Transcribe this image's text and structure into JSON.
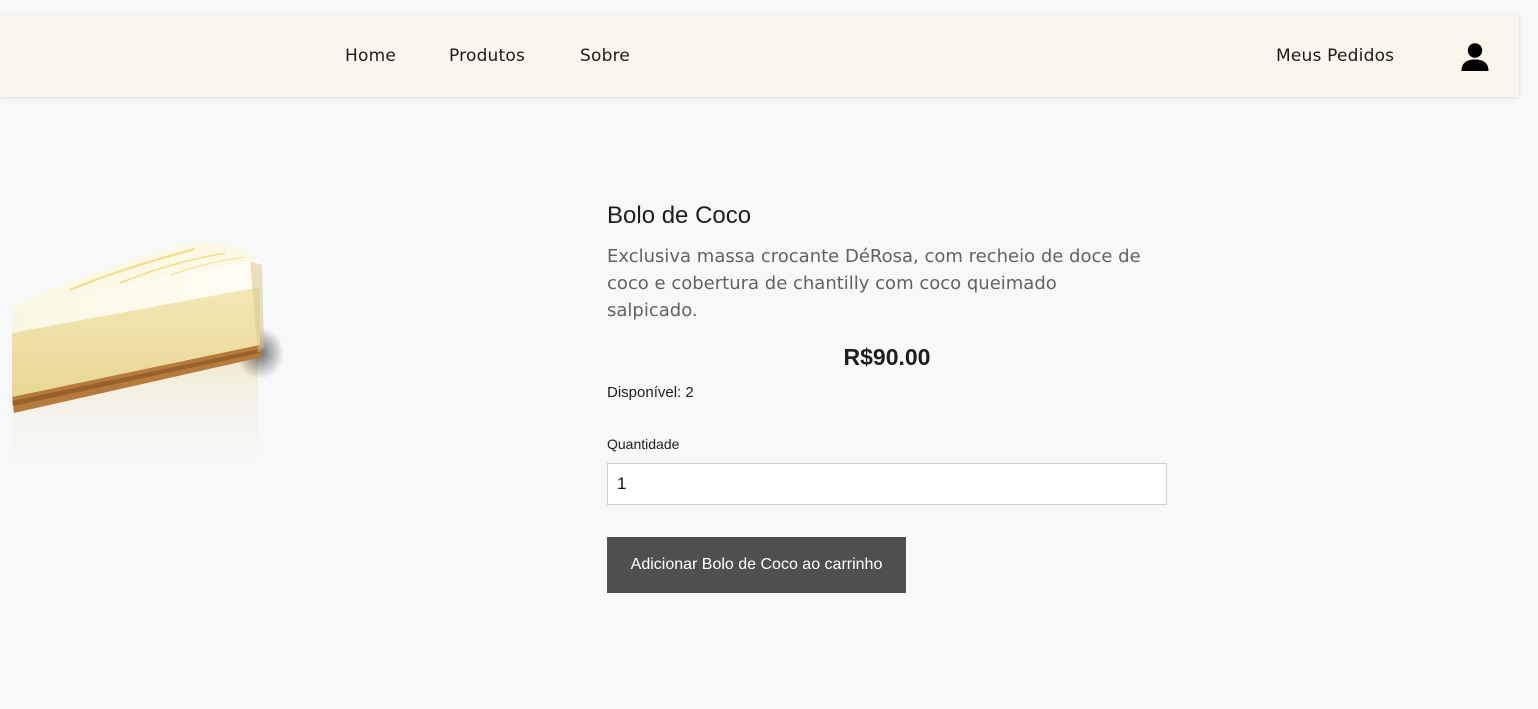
{
  "nav": {
    "home": "Home",
    "products": "Produtos",
    "about": "Sobre",
    "orders": "Meus Pedidos",
    "account_icon": "user-icon"
  },
  "product": {
    "image": "cake-slice-image",
    "name": "Bolo de Coco",
    "description": "Exclusiva massa crocante DéRosa, com recheio de doce de coco e cobertura de chantilly com coco queimado salpicado.",
    "price": "R$90.00",
    "stock": "Disponível: 2",
    "quantity_label": "Quantidade",
    "quantity_value": "1",
    "add_button": "Adicionar Bolo de Coco ao carrinho"
  },
  "colors": {
    "page_background": "#f7f8fa",
    "navbar_background": "#faf6ec",
    "button_background": "#4f4f4f",
    "button_text": "#ffffff"
  }
}
